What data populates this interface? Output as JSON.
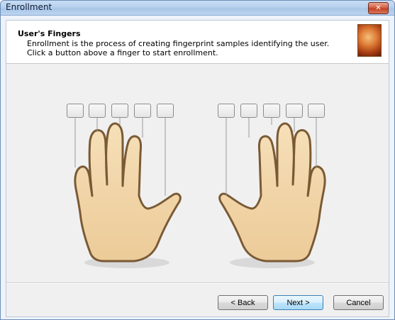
{
  "window": {
    "title": "Enrollment",
    "close_icon": "close-icon"
  },
  "header": {
    "title": "User's Fingers",
    "description": "Enrollment is the process of creating fingerprint samples identifying the user. Click a button above a finger to start enrollment.",
    "image_icon": "fingerprint-hand-image"
  },
  "hands": {
    "left": {
      "finger_buttons": [
        "",
        "",
        "",
        "",
        ""
      ]
    },
    "right": {
      "finger_buttons": [
        "",
        "",
        "",
        "",
        ""
      ]
    }
  },
  "footer": {
    "back_label": "< Back",
    "next_label": "Next >",
    "cancel_label": "Cancel"
  }
}
